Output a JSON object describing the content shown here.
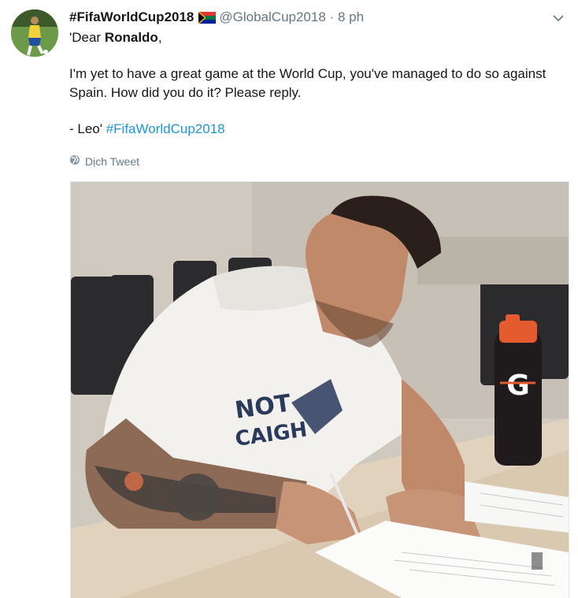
{
  "tweet": {
    "display_name": "#FifaWorldCup2018",
    "handle": "@GlobalCup2018",
    "separator": "·",
    "time": "8 ph",
    "text": {
      "line1_prefix": "'Dear ",
      "line1_bold": "Ronaldo",
      "line1_suffix": ",",
      "line2": "I'm yet to have a great game at the World Cup, you've managed to do so against Spain. How did you do it? Please reply.",
      "line3_prefix": "- Leo' ",
      "line3_hashtag": "#FifaWorldCup2018"
    },
    "translate_label": "Dịch Tweet"
  },
  "icons": {
    "flag": "south-africa-flag-icon",
    "menu": "chevron-down-icon",
    "translate": "globe-icon"
  },
  "photo": {
    "shirt_text_line1": "NOT",
    "shirt_text_line2": "CAIGH",
    "bottle_logo": "G"
  },
  "colors": {
    "link": "#1b95e0",
    "muted": "#657786",
    "text": "#14171a"
  }
}
